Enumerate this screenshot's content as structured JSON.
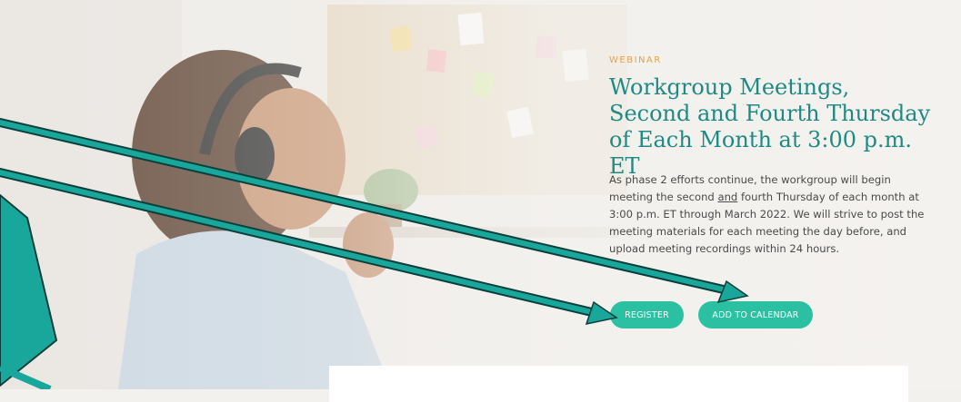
{
  "hero": {
    "eyebrow": "WEBINAR",
    "title": "Workgroup Meetings, Second and Fourth Thursday of Each Month at 3:00 p.m. ET",
    "description_before": "As phase 2 efforts continue, the workgroup will begin meeting the second ",
    "description_underlined": "and",
    "description_after": " fourth Thursday of each month at 3:00 p.m. ET through March 2022.  We will strive to post the meeting materials for each meeting the day before, and upload meeting recordings within 24 hours.",
    "register_label": "REGISTER",
    "calendar_label": "ADD TO CALENDAR"
  },
  "colors": {
    "eyebrow": "#e0a24a",
    "title": "#1f8a84",
    "button": "#2cc0a2",
    "arrow": "#19a79c",
    "arrow_outline": "#0b3f3b"
  },
  "annotations": {
    "arrows": 3,
    "targets": [
      "register-button",
      "add-to-calendar-button"
    ]
  }
}
